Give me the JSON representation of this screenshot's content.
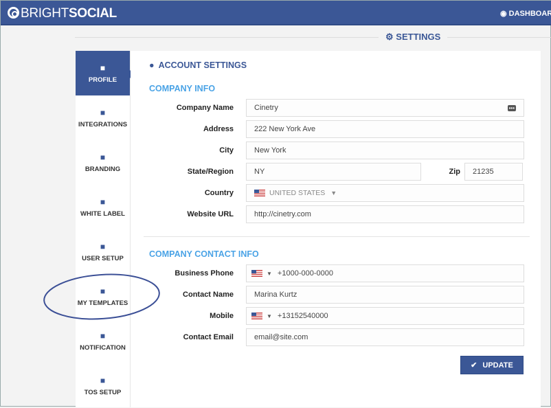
{
  "header": {
    "logo_light": "BRIGHT",
    "logo_bold": "SOCIAL",
    "dashboard": "DASHBOARD"
  },
  "page_title": "SETTINGS",
  "sidebar": [
    {
      "label": "PROFILE",
      "icon": "user-icon",
      "glyph": "👤"
    },
    {
      "label": "INTEGRATIONS",
      "icon": "arrow-circle-icon",
      "glyph": "➲"
    },
    {
      "label": "BRANDING",
      "icon": "brush-icon",
      "glyph": "🖌"
    },
    {
      "label": "WHITE LABEL",
      "icon": "bookmark-icon",
      "glyph": "🔖"
    },
    {
      "label": "USER SETUP",
      "icon": "users-icon",
      "glyph": "👥"
    },
    {
      "label": "MY TEMPLATES",
      "icon": "file-icon",
      "glyph": "📄"
    },
    {
      "label": "NOTIFICATION",
      "icon": "bell-icon",
      "glyph": "🔔"
    },
    {
      "label": "TOS SETUP",
      "icon": "file-icon",
      "glyph": "📄"
    }
  ],
  "account_title": "ACCOUNT SETTINGS",
  "company_info": {
    "title": "COMPANY INFO",
    "company_name_label": "Company Name",
    "company_name": "Cinetry",
    "address_label": "Address",
    "address": "222 New York Ave",
    "city_label": "City",
    "city": "New York",
    "state_label": "State/Region",
    "state": "NY",
    "zip_label": "Zip",
    "zip": "21235",
    "country_label": "Country",
    "country": "UNITED STATES",
    "website_label": "Website URL",
    "website": "http://cinetry.com"
  },
  "contact_info": {
    "title": "COMPANY CONTACT INFO",
    "phone_label": "Business Phone",
    "phone": "+1000-000-0000",
    "name_label": "Contact Name",
    "name": "Marina Kurtz",
    "mobile_label": "Mobile",
    "mobile": "+13152540000",
    "email_label": "Contact Email",
    "email_placeholder": "email@site.com"
  },
  "update_label": "UPDATE",
  "colors": {
    "brand": "#3b5796",
    "section": "#4aa3e6"
  }
}
